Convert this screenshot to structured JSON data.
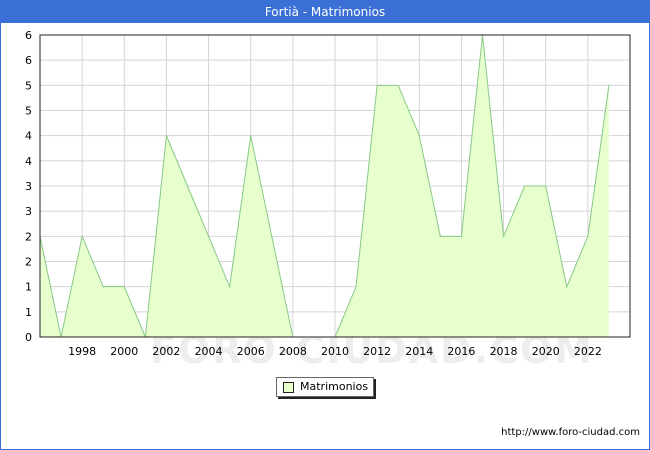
{
  "title": "Fortià - Matrimonios",
  "source_label": "http://www.foro-ciudad.com",
  "watermark": "FORO-CIUDAD.COM",
  "colors": {
    "frame": "#3a6fd6",
    "area_fill": "#e6ffcc",
    "line": "#88c888",
    "grid": "#d4d4d4"
  },
  "chart_data": {
    "type": "area",
    "title": "Fortià - Matrimonios",
    "xlabel": "",
    "ylabel": "",
    "x": [
      1996,
      1997,
      1998,
      1999,
      2000,
      2001,
      2002,
      2003,
      2004,
      2005,
      2006,
      2007,
      2008,
      2009,
      2010,
      2011,
      2012,
      2013,
      2014,
      2015,
      2016,
      2017,
      2018,
      2019,
      2020,
      2021,
      2022,
      2023
    ],
    "series": [
      {
        "name": "Matrimonios",
        "values": [
          2,
          0,
          2,
          1,
          1,
          0,
          4,
          3,
          2,
          1,
          4,
          2,
          0,
          0,
          0,
          1,
          5,
          5,
          4,
          2,
          2,
          6,
          2,
          3,
          3,
          1,
          2,
          5
        ]
      }
    ],
    "x_ticks": [
      "1998",
      "2000",
      "2002",
      "2004",
      "2006",
      "2008",
      "2010",
      "2012",
      "2014",
      "2016",
      "2018",
      "2020",
      "2022"
    ],
    "y_ticks": [
      "0",
      "1",
      "1",
      "2",
      "2",
      "3",
      "3",
      "4",
      "4",
      "5",
      "5",
      "6",
      "6"
    ],
    "ylim": [
      0,
      6
    ],
    "grid": true,
    "legend": "bottom-center"
  }
}
